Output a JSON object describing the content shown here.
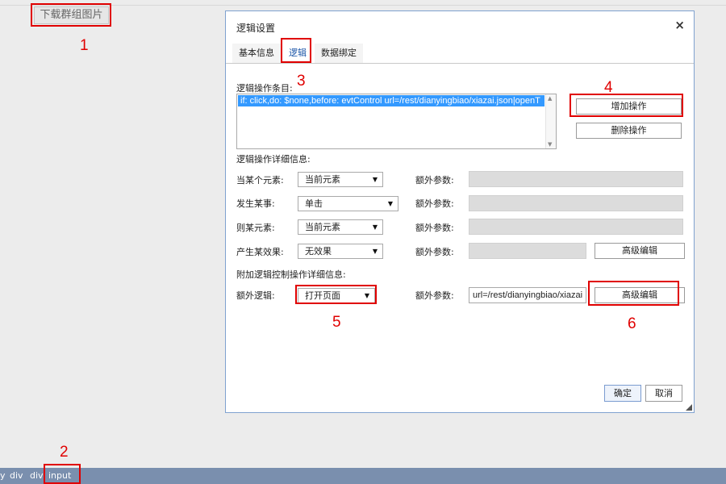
{
  "page": {
    "download_button": "下载群组图片"
  },
  "annotations": [
    "1",
    "2",
    "3",
    "4",
    "5",
    "6"
  ],
  "dialog": {
    "title": "逻辑设置",
    "close": "×",
    "tabs": [
      {
        "label": "基本信息",
        "active": false
      },
      {
        "label": "逻辑",
        "active": true
      },
      {
        "label": "数据绑定",
        "active": false
      }
    ],
    "ops_list_label": "逻辑操作条目:",
    "ops_list_item": "if: click,do: $none,before: evtControl url=/rest/dianyingbiao/xiazai.json|openT",
    "add_op_button": "增加操作",
    "delete_op_button": "删除操作",
    "detail_label": "逻辑操作详细信息:",
    "rows": [
      {
        "label": "当某个元素:",
        "value": "当前元素",
        "param_label": "额外参数:"
      },
      {
        "label": "发生某事:",
        "value": "单击",
        "param_label": "额外参数:"
      },
      {
        "label": "则某元素:",
        "value": "当前元素",
        "param_label": "额外参数:"
      },
      {
        "label": "产生某效果:",
        "value": "无效果",
        "param_label": "额外参数:",
        "button": "高级编辑"
      }
    ],
    "extra_section_label": "附加逻辑控制操作详细信息:",
    "extra_row": {
      "label": "额外逻辑:",
      "value": "打开页面",
      "param_label": "额外参数:",
      "param_value": "url=/rest/dianyingbiao/xiazai",
      "button": "高级编辑"
    },
    "ok_button": "确定",
    "cancel_button": "取消"
  },
  "statusbar": {
    "crumbs": [
      "y",
      "div",
      "div",
      "input"
    ]
  },
  "colors": {
    "annotation": "#e00000",
    "active_tab": "#1c56a8",
    "selection": "#3399ff",
    "statusbar": "#7a8fae"
  }
}
